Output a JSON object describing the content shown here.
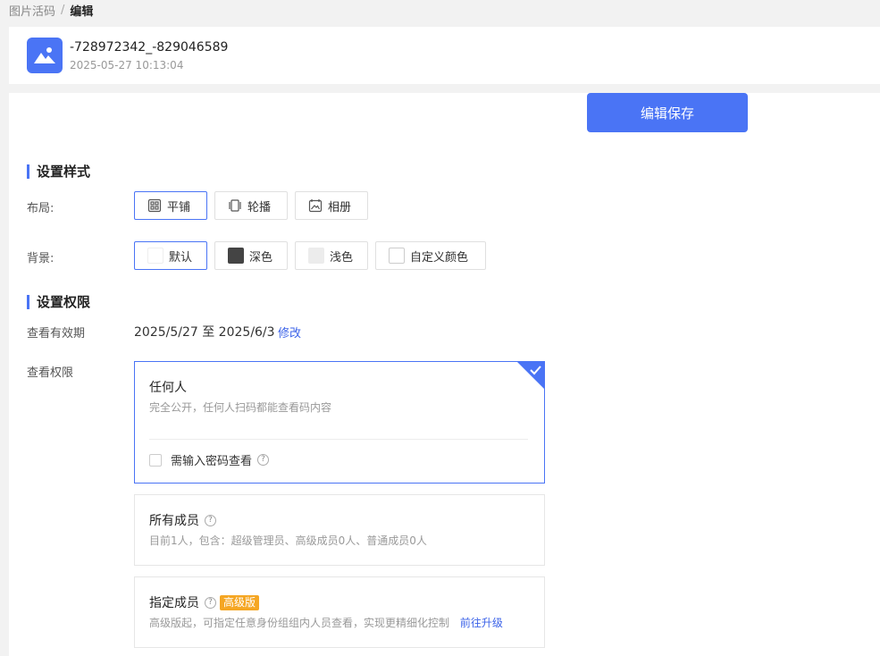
{
  "breadcrumb": {
    "parent": "图片活码",
    "separator": "/",
    "current": "编辑"
  },
  "header": {
    "title": "-728972342_-829046589",
    "timestamp": "2025-05-27 10:13:04",
    "thumb_icon": "image-icon"
  },
  "toolbar": {
    "save_label": "编辑保存"
  },
  "style_section": {
    "title": "设置样式",
    "layout_label": "布局:",
    "layout_options": [
      {
        "label": "平铺",
        "icon": "grid-icon",
        "selected": true
      },
      {
        "label": "轮播",
        "icon": "carousel-icon",
        "selected": false
      },
      {
        "label": "相册",
        "icon": "album-icon",
        "selected": false
      }
    ],
    "background_label": "背景:",
    "background_options": [
      {
        "label": "默认",
        "color": "#ffffff",
        "selected": true
      },
      {
        "label": "深色",
        "color": "#444444",
        "selected": false
      },
      {
        "label": "浅色",
        "color": "#ececec",
        "selected": false
      },
      {
        "label": "自定义颜色",
        "color": "#ffffff",
        "selected": false
      }
    ]
  },
  "permission_section": {
    "title": "设置权限",
    "validity_label": "查看有效期",
    "validity_value": "2025/5/27 至 2025/6/3",
    "validity_edit": "修改",
    "access_label": "查看权限",
    "cards": [
      {
        "title": "任何人",
        "desc": "完全公开，任何人扫码都能查看码内容",
        "selected": true,
        "password_label": "需输入密码查看",
        "password_checked": false
      },
      {
        "title": "所有成员",
        "desc": "目前1人，包含：超级管理员、高级成员0人、普通成员0人",
        "selected": false
      },
      {
        "title": "指定成员",
        "badge": "高级版",
        "desc": "高级版起，可指定任意身份组组内人员查看，实现更精细化控制",
        "link": "前往升级",
        "selected": false
      }
    ]
  },
  "colors": {
    "accent": "#4a74f5",
    "badge": "#f5a623",
    "link": "#3c63e8"
  }
}
